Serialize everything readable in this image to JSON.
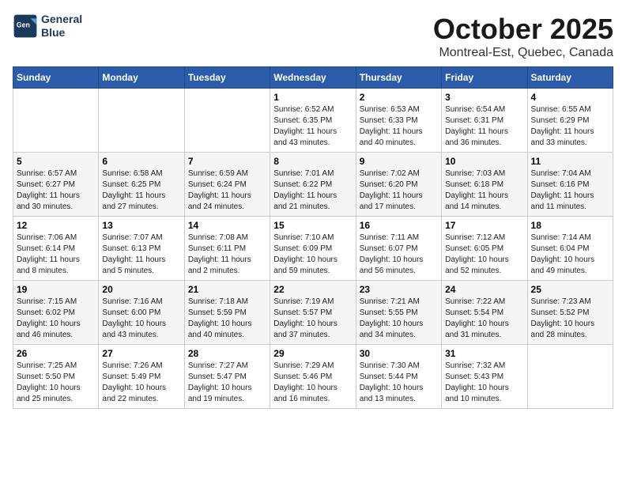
{
  "logo": {
    "line1": "General",
    "line2": "Blue"
  },
  "title": "October 2025",
  "subtitle": "Montreal-Est, Quebec, Canada",
  "headers": [
    "Sunday",
    "Monday",
    "Tuesday",
    "Wednesday",
    "Thursday",
    "Friday",
    "Saturday"
  ],
  "weeks": [
    [
      {
        "day": "",
        "info": ""
      },
      {
        "day": "",
        "info": ""
      },
      {
        "day": "",
        "info": ""
      },
      {
        "day": "1",
        "info": "Sunrise: 6:52 AM\nSunset: 6:35 PM\nDaylight: 11 hours\nand 43 minutes."
      },
      {
        "day": "2",
        "info": "Sunrise: 6:53 AM\nSunset: 6:33 PM\nDaylight: 11 hours\nand 40 minutes."
      },
      {
        "day": "3",
        "info": "Sunrise: 6:54 AM\nSunset: 6:31 PM\nDaylight: 11 hours\nand 36 minutes."
      },
      {
        "day": "4",
        "info": "Sunrise: 6:55 AM\nSunset: 6:29 PM\nDaylight: 11 hours\nand 33 minutes."
      }
    ],
    [
      {
        "day": "5",
        "info": "Sunrise: 6:57 AM\nSunset: 6:27 PM\nDaylight: 11 hours\nand 30 minutes."
      },
      {
        "day": "6",
        "info": "Sunrise: 6:58 AM\nSunset: 6:25 PM\nDaylight: 11 hours\nand 27 minutes."
      },
      {
        "day": "7",
        "info": "Sunrise: 6:59 AM\nSunset: 6:24 PM\nDaylight: 11 hours\nand 24 minutes."
      },
      {
        "day": "8",
        "info": "Sunrise: 7:01 AM\nSunset: 6:22 PM\nDaylight: 11 hours\nand 21 minutes."
      },
      {
        "day": "9",
        "info": "Sunrise: 7:02 AM\nSunset: 6:20 PM\nDaylight: 11 hours\nand 17 minutes."
      },
      {
        "day": "10",
        "info": "Sunrise: 7:03 AM\nSunset: 6:18 PM\nDaylight: 11 hours\nand 14 minutes."
      },
      {
        "day": "11",
        "info": "Sunrise: 7:04 AM\nSunset: 6:16 PM\nDaylight: 11 hours\nand 11 minutes."
      }
    ],
    [
      {
        "day": "12",
        "info": "Sunrise: 7:06 AM\nSunset: 6:14 PM\nDaylight: 11 hours\nand 8 minutes."
      },
      {
        "day": "13",
        "info": "Sunrise: 7:07 AM\nSunset: 6:13 PM\nDaylight: 11 hours\nand 5 minutes."
      },
      {
        "day": "14",
        "info": "Sunrise: 7:08 AM\nSunset: 6:11 PM\nDaylight: 11 hours\nand 2 minutes."
      },
      {
        "day": "15",
        "info": "Sunrise: 7:10 AM\nSunset: 6:09 PM\nDaylight: 10 hours\nand 59 minutes."
      },
      {
        "day": "16",
        "info": "Sunrise: 7:11 AM\nSunset: 6:07 PM\nDaylight: 10 hours\nand 56 minutes."
      },
      {
        "day": "17",
        "info": "Sunrise: 7:12 AM\nSunset: 6:05 PM\nDaylight: 10 hours\nand 52 minutes."
      },
      {
        "day": "18",
        "info": "Sunrise: 7:14 AM\nSunset: 6:04 PM\nDaylight: 10 hours\nand 49 minutes."
      }
    ],
    [
      {
        "day": "19",
        "info": "Sunrise: 7:15 AM\nSunset: 6:02 PM\nDaylight: 10 hours\nand 46 minutes."
      },
      {
        "day": "20",
        "info": "Sunrise: 7:16 AM\nSunset: 6:00 PM\nDaylight: 10 hours\nand 43 minutes."
      },
      {
        "day": "21",
        "info": "Sunrise: 7:18 AM\nSunset: 5:59 PM\nDaylight: 10 hours\nand 40 minutes."
      },
      {
        "day": "22",
        "info": "Sunrise: 7:19 AM\nSunset: 5:57 PM\nDaylight: 10 hours\nand 37 minutes."
      },
      {
        "day": "23",
        "info": "Sunrise: 7:21 AM\nSunset: 5:55 PM\nDaylight: 10 hours\nand 34 minutes."
      },
      {
        "day": "24",
        "info": "Sunrise: 7:22 AM\nSunset: 5:54 PM\nDaylight: 10 hours\nand 31 minutes."
      },
      {
        "day": "25",
        "info": "Sunrise: 7:23 AM\nSunset: 5:52 PM\nDaylight: 10 hours\nand 28 minutes."
      }
    ],
    [
      {
        "day": "26",
        "info": "Sunrise: 7:25 AM\nSunset: 5:50 PM\nDaylight: 10 hours\nand 25 minutes."
      },
      {
        "day": "27",
        "info": "Sunrise: 7:26 AM\nSunset: 5:49 PM\nDaylight: 10 hours\nand 22 minutes."
      },
      {
        "day": "28",
        "info": "Sunrise: 7:27 AM\nSunset: 5:47 PM\nDaylight: 10 hours\nand 19 minutes."
      },
      {
        "day": "29",
        "info": "Sunrise: 7:29 AM\nSunset: 5:46 PM\nDaylight: 10 hours\nand 16 minutes."
      },
      {
        "day": "30",
        "info": "Sunrise: 7:30 AM\nSunset: 5:44 PM\nDaylight: 10 hours\nand 13 minutes."
      },
      {
        "day": "31",
        "info": "Sunrise: 7:32 AM\nSunset: 5:43 PM\nDaylight: 10 hours\nand 10 minutes."
      },
      {
        "day": "",
        "info": ""
      }
    ]
  ]
}
